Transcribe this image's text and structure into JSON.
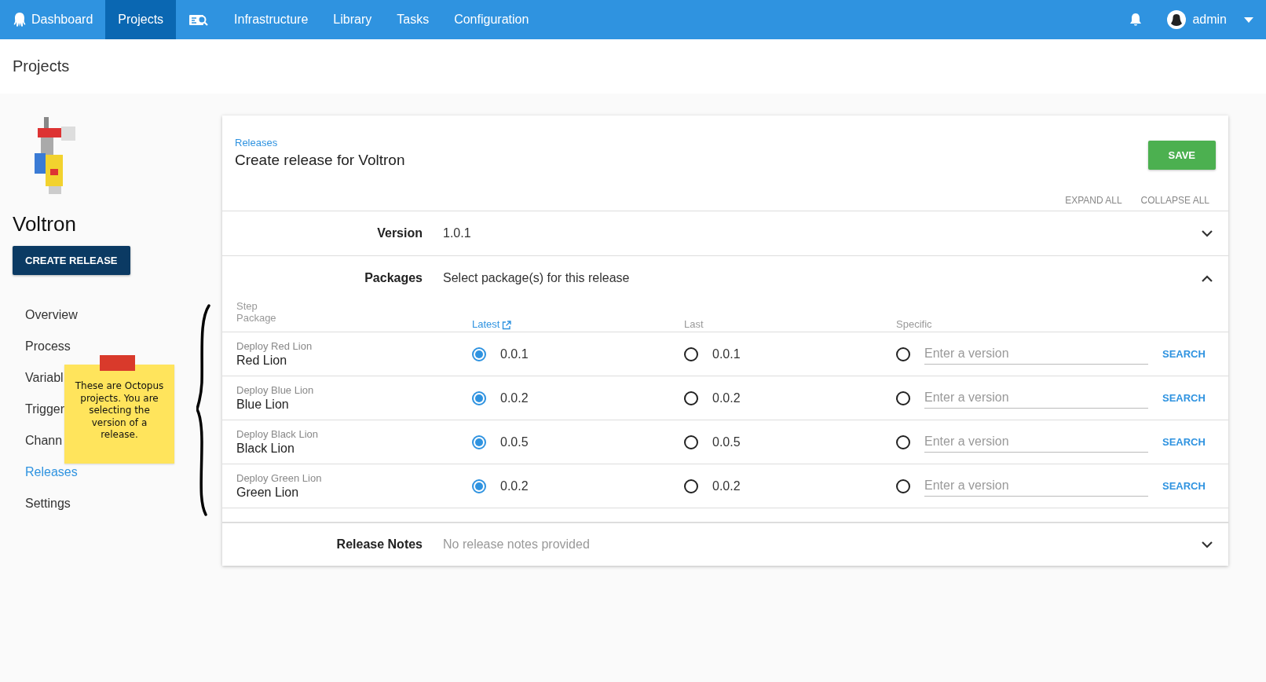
{
  "topnav": {
    "items": [
      {
        "kind": "logo",
        "label": "Dashboard",
        "selected": false
      },
      {
        "kind": "text",
        "label": "Projects",
        "selected": true
      },
      {
        "kind": "icon",
        "selected": false
      },
      {
        "kind": "text",
        "label": "Infrastructure",
        "selected": false
      },
      {
        "kind": "text",
        "label": "Library",
        "selected": false
      },
      {
        "kind": "text",
        "label": "Tasks",
        "selected": false
      },
      {
        "kind": "text",
        "label": "Configuration",
        "selected": false
      }
    ],
    "user": "admin"
  },
  "page_title": "Projects",
  "sidebar": {
    "project_name": "Voltron",
    "create_button": "CREATE RELEASE",
    "items": [
      {
        "label": "Overview",
        "selected": false
      },
      {
        "label": "Process",
        "selected": false
      },
      {
        "label": "Variabl",
        "selected": false
      },
      {
        "label": "Trigger",
        "selected": false
      },
      {
        "label": "Chann",
        "selected": false
      },
      {
        "label": "Releases",
        "selected": true
      },
      {
        "label": "Settings",
        "selected": false
      }
    ]
  },
  "sticky_note": "These are Octopus projects.  You are selecting the version of a release.",
  "card": {
    "breadcrumb": "Releases",
    "title": "Create release for Voltron",
    "save_button": "SAVE",
    "expand_all": "EXPAND ALL",
    "collapse_all": "COLLAPSE ALL",
    "version": {
      "label": "Version",
      "value": "1.0.1",
      "expanded": false
    },
    "packages": {
      "label": "Packages",
      "summary": "Select package(s) for this release",
      "expanded": true,
      "columns": {
        "step": "Step",
        "package": "Package",
        "latest": "Latest",
        "last": "Last",
        "specific": "Specific"
      },
      "rows": [
        {
          "step": "Deploy Red Lion",
          "package": "Red Lion",
          "latest": {
            "version": "0.0.1",
            "selected": true
          },
          "last": {
            "version": "0.0.1",
            "selected": false
          },
          "specific": {
            "placeholder": "Enter a version",
            "selected": false
          },
          "search": "SEARCH"
        },
        {
          "step": "Deploy Blue Lion",
          "package": "Blue Lion",
          "latest": {
            "version": "0.0.2",
            "selected": true
          },
          "last": {
            "version": "0.0.2",
            "selected": false
          },
          "specific": {
            "placeholder": "Enter a version",
            "selected": false
          },
          "search": "SEARCH"
        },
        {
          "step": "Deploy Black Lion",
          "package": "Black Lion",
          "latest": {
            "version": "0.0.5",
            "selected": true
          },
          "last": {
            "version": "0.0.5",
            "selected": false
          },
          "specific": {
            "placeholder": "Enter a version",
            "selected": false
          },
          "search": "SEARCH"
        },
        {
          "step": "Deploy Green Lion",
          "package": "Green Lion",
          "latest": {
            "version": "0.0.2",
            "selected": true
          },
          "last": {
            "version": "0.0.2",
            "selected": false
          },
          "specific": {
            "placeholder": "Enter a version",
            "selected": false
          },
          "search": "SEARCH"
        }
      ]
    },
    "release_notes": {
      "label": "Release Notes",
      "value": "No release notes provided",
      "expanded": false
    }
  }
}
